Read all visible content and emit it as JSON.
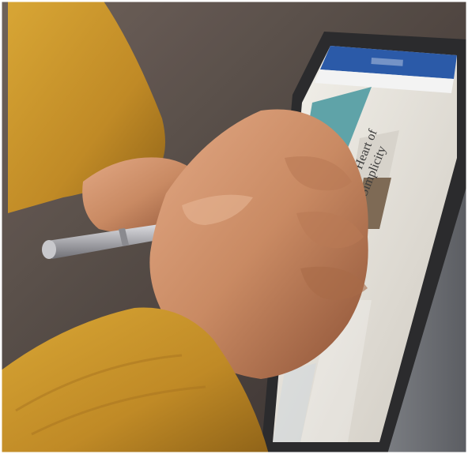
{
  "photo": {
    "subject": "Hand writing on a tablet screen with a stylus pen",
    "screen_doc": {
      "heading_line_1": "Heart of",
      "heading_line_2": "Simplicity"
    }
  },
  "colors": {
    "sweater": "#c9962a",
    "sweater_dark": "#a87420",
    "skin": "#c98a63",
    "skin_shadow": "#9a5a3a",
    "couch": "#5a4f4a",
    "tablet_frame": "#2b2b2d",
    "screen": "#e9e7e2",
    "ribbon": "#2b5aa8",
    "pen": "#b8b8bc",
    "cover": "#7c7e82"
  }
}
